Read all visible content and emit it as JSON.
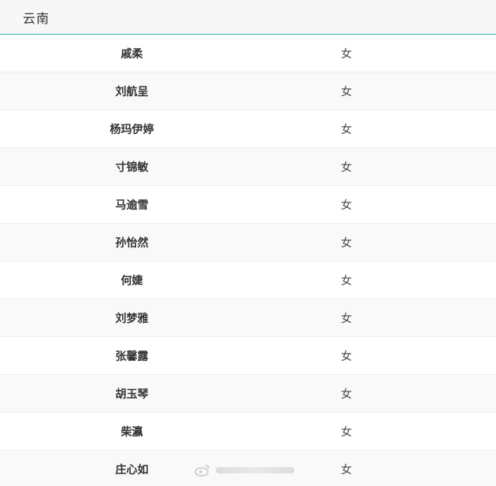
{
  "header": {
    "title": "云南"
  },
  "rows": [
    {
      "name": "戚柔",
      "gender": "女"
    },
    {
      "name": "刘航呈",
      "gender": "女"
    },
    {
      "name": "杨玛伊婷",
      "gender": "女"
    },
    {
      "name": "寸锦敏",
      "gender": "女"
    },
    {
      "name": "马逾雪",
      "gender": "女"
    },
    {
      "name": "孙怡然",
      "gender": "女"
    },
    {
      "name": "何婕",
      "gender": "女"
    },
    {
      "name": "刘梦雅",
      "gender": "女"
    },
    {
      "name": "张馨露",
      "gender": "女"
    },
    {
      "name": "胡玉琴",
      "gender": "女"
    },
    {
      "name": "柴瀛",
      "gender": "女"
    },
    {
      "name": "庄心如",
      "gender": "女"
    }
  ],
  "watermark": {
    "icon": "weibo-logo-icon"
  }
}
